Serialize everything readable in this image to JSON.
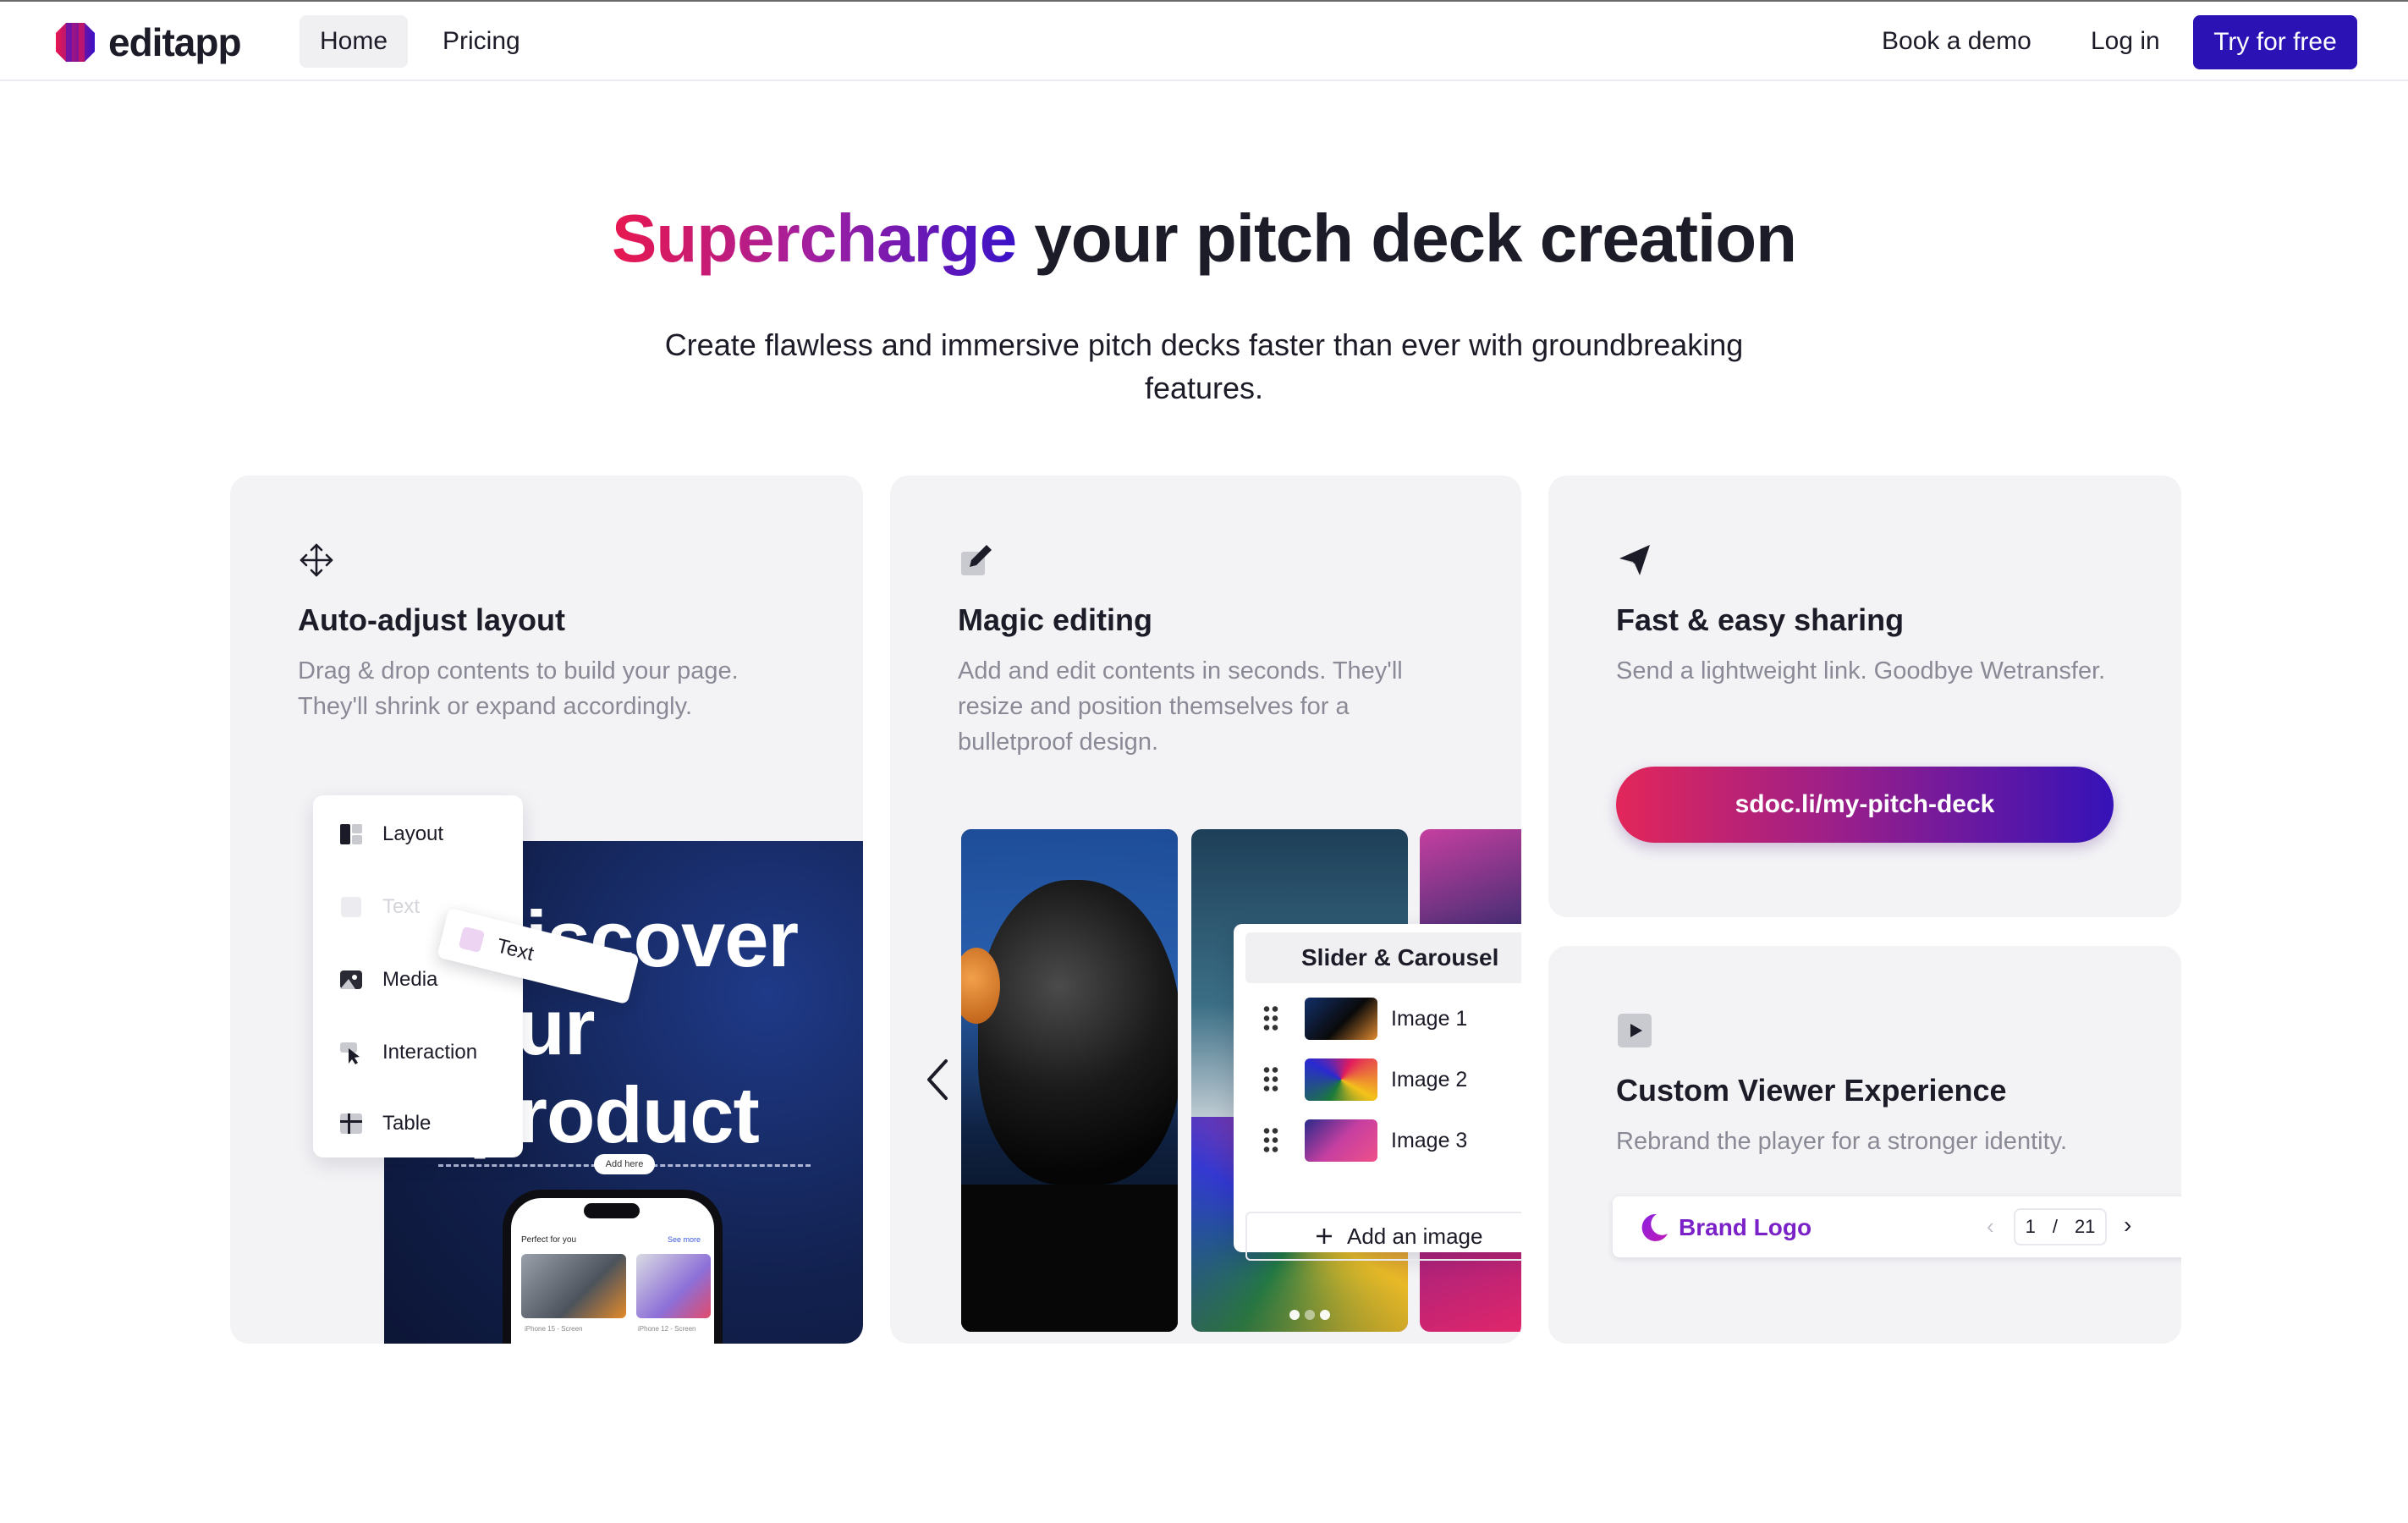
{
  "nav": {
    "logo_text": "editapp",
    "home": "Home",
    "pricing": "Pricing",
    "book_demo": "Book a demo",
    "login": "Log in",
    "cta": "Try for free"
  },
  "hero": {
    "title_highlight": "Supercharge",
    "title_rest": " your pitch deck creation",
    "subtitle": "Create flawless and immersive pitch decks faster than ever with groundbreaking features."
  },
  "cards": [
    {
      "icon": "move-arrows-icon",
      "title": "Auto-adjust layout",
      "description": "Drag & drop contents to build your page. They'll shrink or expand accordingly.",
      "mock": {
        "headline": "Discover\nour\nproduct",
        "add_here": "Add here",
        "phone_title": "Perfect for you",
        "phone_see_more": "See more",
        "phone_caption_1": "iPhone 15 - Screen",
        "phone_caption_2": "iPhone 12 - Screen",
        "menu": [
          "Layout",
          "Text",
          "Media",
          "Interaction",
          "Table"
        ],
        "drag_label": "Text"
      }
    },
    {
      "icon": "pencil-icon",
      "title": "Magic editing",
      "description": "Add and edit contents in seconds. They'll resize and position themselves for a bulletproof design.",
      "mock": {
        "panel_title": "Slider & Carousel",
        "items": [
          "Image 1",
          "Image 2",
          "Image 3"
        ],
        "add_image": "Add an image"
      }
    },
    {
      "icon": "paper-plane-icon",
      "title": "Fast & easy sharing",
      "description": "Send a lightweight link. Goodbye Wetransfer.",
      "link": "sdoc.li/my-pitch-deck"
    },
    {
      "icon": "play-icon",
      "title": "Custom Viewer Experience",
      "description": "Rebrand the player for a stronger identity.",
      "player": {
        "brand": "Brand Logo",
        "page_current": "1",
        "page_sep": "/",
        "page_total": "21"
      }
    }
  ],
  "colors": {
    "primary": "#2a12b5",
    "gradient_start": "#e8174f",
    "gradient_end": "#3a12c8",
    "card_bg": "#f3f3f6",
    "muted_text": "#8a8a96"
  }
}
